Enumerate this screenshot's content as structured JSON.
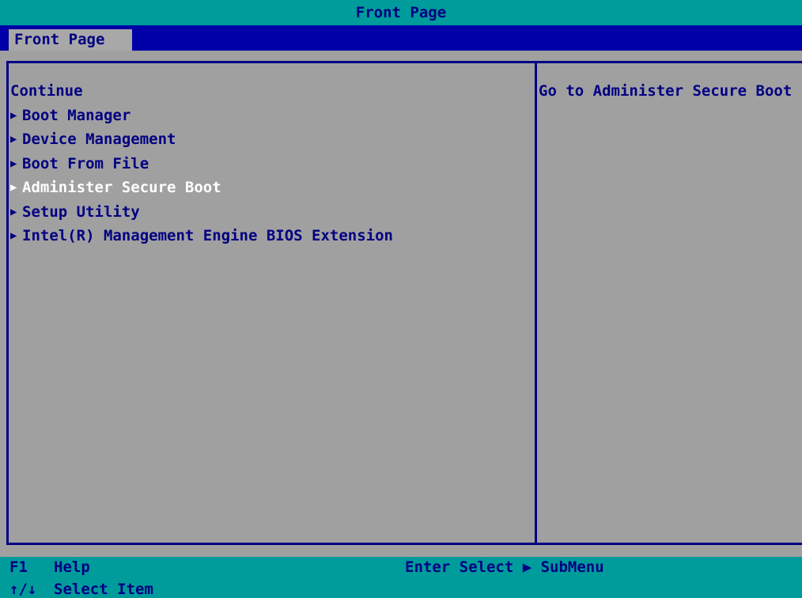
{
  "window": {
    "title": "Front Page"
  },
  "tabs": [
    {
      "label": "Front Page"
    }
  ],
  "menu": {
    "items": [
      {
        "label": "Continue",
        "submenu": false
      },
      {
        "label": "Boot Manager",
        "submenu": true
      },
      {
        "label": "Device Management",
        "submenu": true
      },
      {
        "label": "Boot From File",
        "submenu": true
      },
      {
        "label": "Administer Secure Boot",
        "submenu": true,
        "selected": true
      },
      {
        "label": "Setup Utility",
        "submenu": true
      },
      {
        "label": "Intel(R) Management Engine BIOS Extension",
        "submenu": true
      }
    ],
    "submenu_glyph": "▶"
  },
  "help": {
    "text": "Go to Administer Secure Boot"
  },
  "footer": {
    "f1_key": "F1",
    "f1_label": "Help",
    "arrows_key": "↑/↓",
    "arrows_label": "Select Item",
    "enter_hint": "Enter Select ▶ SubMenu"
  },
  "colors": {
    "title_bar": "#009b9b",
    "tab_bar": "#0000a8",
    "background": "#a0a0a0",
    "text": "#000082",
    "selected_text": "#ffffff"
  }
}
